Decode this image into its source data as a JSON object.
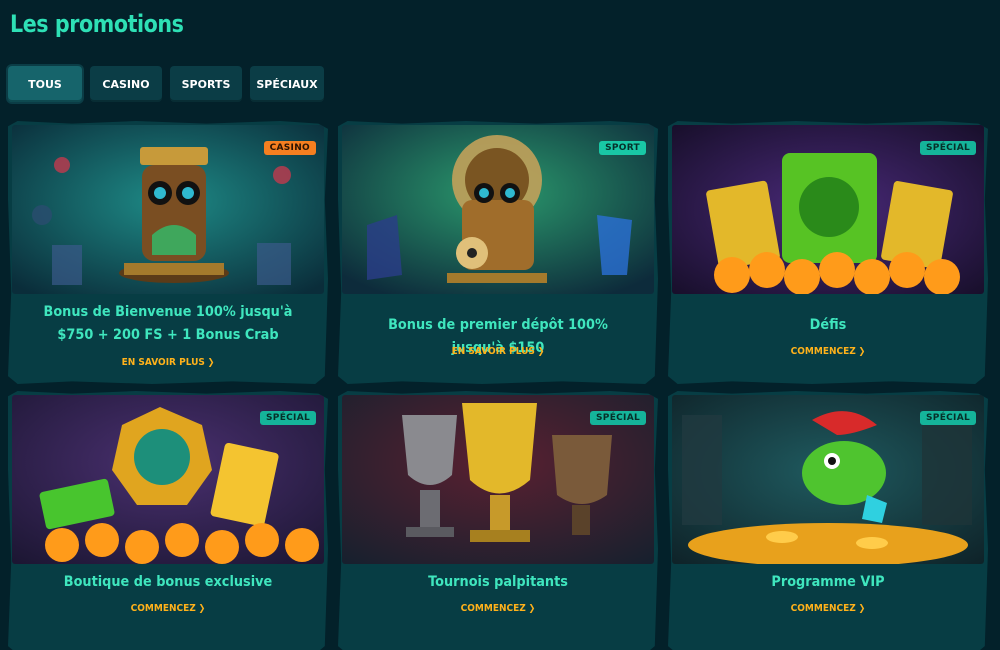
{
  "page": {
    "title": "Les promotions"
  },
  "tabs": [
    {
      "label": "TOUS",
      "active": true
    },
    {
      "label": "CASINO",
      "active": false
    },
    {
      "label": "SPORTS",
      "active": false
    },
    {
      "label": "SPÉCIAUX",
      "active": false
    }
  ],
  "cards": [
    {
      "badge": "CASINO",
      "title": "Bonus de Bienvenue 100% jusqu'à $750 + 200 FS + 1 Bonus Crab",
      "cta": "EN SAVOIR PLUS",
      "art": "golden monkey statue"
    },
    {
      "badge": "SPORT",
      "title": "Bonus de premier dépôt 100% jusqu'à $150",
      "cta": "EN SAVOIR PLUS",
      "art": "monkey with football"
    },
    {
      "badge": "SPÉCIAL",
      "title": "Défis",
      "cta": "COMMENCEZ",
      "art": "green idol and coins"
    },
    {
      "badge": "SPÉCIAL",
      "title": "Boutique de bonus exclusive",
      "cta": "COMMENCEZ",
      "art": "coin hexagon and cash"
    },
    {
      "badge": "SPÉCIAL",
      "title": "Tournois palpitants",
      "cta": "COMMENCEZ",
      "art": "trophies 1 2 3"
    },
    {
      "badge": "SPÉCIAL",
      "title": "Programme VIP",
      "cta": "COMMENCEZ",
      "art": "chameleon on gold"
    }
  ],
  "colors": {
    "background": "#03212a",
    "card": "#073d44",
    "title": "#2ee0b5",
    "cta": "#ffb21b",
    "badge_casino": "#f57f20",
    "badge_special": "#15b49a"
  },
  "icons": {
    "cta_chevron": "chevron-right-icon"
  }
}
